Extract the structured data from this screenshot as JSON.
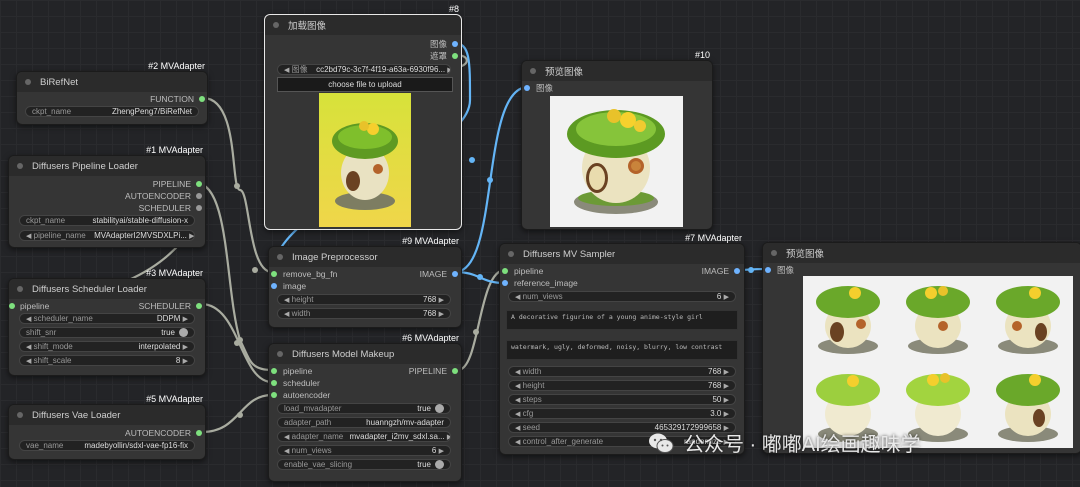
{
  "nodes": {
    "birefnet": {
      "title": "BiRefNet",
      "badge": "#2 MVAdapter",
      "out": "FUNCTION",
      "w_label": "ckpt_name",
      "w_value": "ZhengPeng7/BiRefNet"
    },
    "pipeline_loader": {
      "title": "Diffusers Pipeline Loader",
      "badge": "#1 MVAdapter",
      "outs": [
        "PIPELINE",
        "AUTOENCODER",
        "SCHEDULER"
      ],
      "w1_label": "ckpt_name",
      "w1_value": "stabilityai/stable-diffusion-x",
      "w2_label": "pipeline_name",
      "w2_value": "MVAdapterI2MVSDXLPi..."
    },
    "scheduler_loader": {
      "title": "Diffusers Scheduler Loader",
      "badge": "#3 MVAdapter",
      "in": "pipeline",
      "out": "SCHEDULER",
      "widgets": [
        {
          "label": "scheduler_name",
          "value": "DDPM"
        },
        {
          "label": "shift_snr",
          "value": "true"
        },
        {
          "label": "shift_mode",
          "value": "interpolated"
        },
        {
          "label": "shift_scale",
          "value": "8"
        }
      ]
    },
    "vae_loader": {
      "title": "Diffusers Vae Loader",
      "badge": "#5 MVAdapter",
      "out": "AUTOENCODER",
      "w_label": "vae_name",
      "w_value": "madebyollin/sdxl-vae-fp16-fix"
    },
    "load_image": {
      "title": "加载图像",
      "badge": "#8",
      "outs": [
        "图像",
        "遮罩"
      ],
      "w_label": "图像",
      "w_value": "cc2bd79c-3c7f-4f19-a63a-6930f96...",
      "button": "choose file to upload"
    },
    "preprocessor": {
      "title": "Image Preprocessor",
      "badge": "#9 MVAdapter",
      "ins": [
        "remove_bg_fn",
        "image"
      ],
      "out": "IMAGE",
      "widgets": [
        {
          "label": "height",
          "value": "768"
        },
        {
          "label": "width",
          "value": "768"
        }
      ]
    },
    "makeup": {
      "title": "Diffusers Model Makeup",
      "badge": "#6 MVAdapter",
      "ins": [
        "pipeline",
        "scheduler",
        "autoencoder"
      ],
      "out": "PIPELINE",
      "widgets": [
        {
          "label": "load_mvadapter",
          "value": "true"
        },
        {
          "label": "adapter_path",
          "value": "huanngzh/mv-adapter"
        },
        {
          "label": "adapter_name",
          "value": "mvadapter_i2mv_sdxl.sa..."
        },
        {
          "label": "num_views",
          "value": "6"
        },
        {
          "label": "enable_vae_slicing",
          "value": "true"
        }
      ]
    },
    "preview1": {
      "title": "预览图像",
      "badge": "#10",
      "in": "图像"
    },
    "sampler": {
      "title": "Diffusers MV Sampler",
      "badge": "#7 MVAdapter",
      "ins": [
        "pipeline",
        "reference_image"
      ],
      "out": "IMAGE",
      "num_views_label": "num_views",
      "num_views_value": "6",
      "prompt": "A decorative figurine of a young anime-style girl",
      "negative": "watermark, ugly, deformed, noisy, blurry, low contrast",
      "widgets": [
        {
          "label": "width",
          "value": "768"
        },
        {
          "label": "height",
          "value": "768"
        },
        {
          "label": "steps",
          "value": "50"
        },
        {
          "label": "cfg",
          "value": "3.0"
        },
        {
          "label": "seed",
          "value": "465329172999658"
        },
        {
          "label": "control_after_generate",
          "value": "randomize"
        }
      ]
    },
    "preview2": {
      "title": "预览图像",
      "in": "图像"
    }
  },
  "watermark": "公众号 · 嘟嘟AI绘画趣味学",
  "colors": {
    "wire": "#a9aca0",
    "image_wire": "#64b5f6",
    "pin_green": "#7ee07e",
    "pin_blue": "#6fb3ff",
    "pin_gray": "#999999"
  }
}
